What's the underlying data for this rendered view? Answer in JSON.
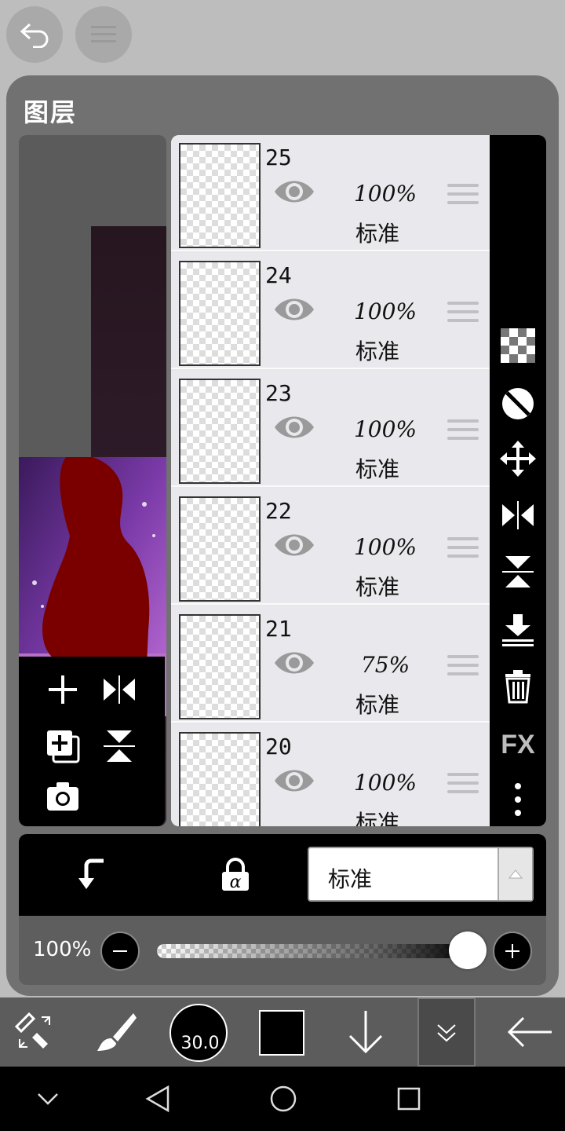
{
  "panel": {
    "title": "图层"
  },
  "layers": [
    {
      "number": "25",
      "opacity": "100%",
      "blend": "标准"
    },
    {
      "number": "24",
      "opacity": "100%",
      "blend": "标准"
    },
    {
      "number": "23",
      "opacity": "100%",
      "blend": "标准"
    },
    {
      "number": "22",
      "opacity": "100%",
      "blend": "标准"
    },
    {
      "number": "21",
      "opacity": "75%",
      "blend": "标准"
    },
    {
      "number": "20",
      "opacity": "100%",
      "blend": "标准"
    }
  ],
  "right_tools": {
    "fx_label": "FX"
  },
  "blend_mode": {
    "selected": "标准"
  },
  "opacity": {
    "label": "100%",
    "value": 1.0
  },
  "brush": {
    "size_label": "30.0"
  },
  "colors": {
    "primary": "#000000",
    "accent_silhouette": "#7a0000",
    "thumb_purple": "#6a2a9a"
  },
  "icons": [
    "undo-icon",
    "menu-icon",
    "eye-icon",
    "drag-handle-icon",
    "checker-icon",
    "circle-slash-icon",
    "move-icon",
    "flip-horizontal-icon",
    "flip-vertical-icon",
    "merge-down-icon",
    "trash-icon",
    "more-icon",
    "add-icon",
    "duplicate-icon",
    "camera-icon",
    "clipping-icon",
    "alpha-lock-icon",
    "transform-icon",
    "brush-icon",
    "arrow-down-icon",
    "chevron-down-icon",
    "back-arrow-icon"
  ]
}
